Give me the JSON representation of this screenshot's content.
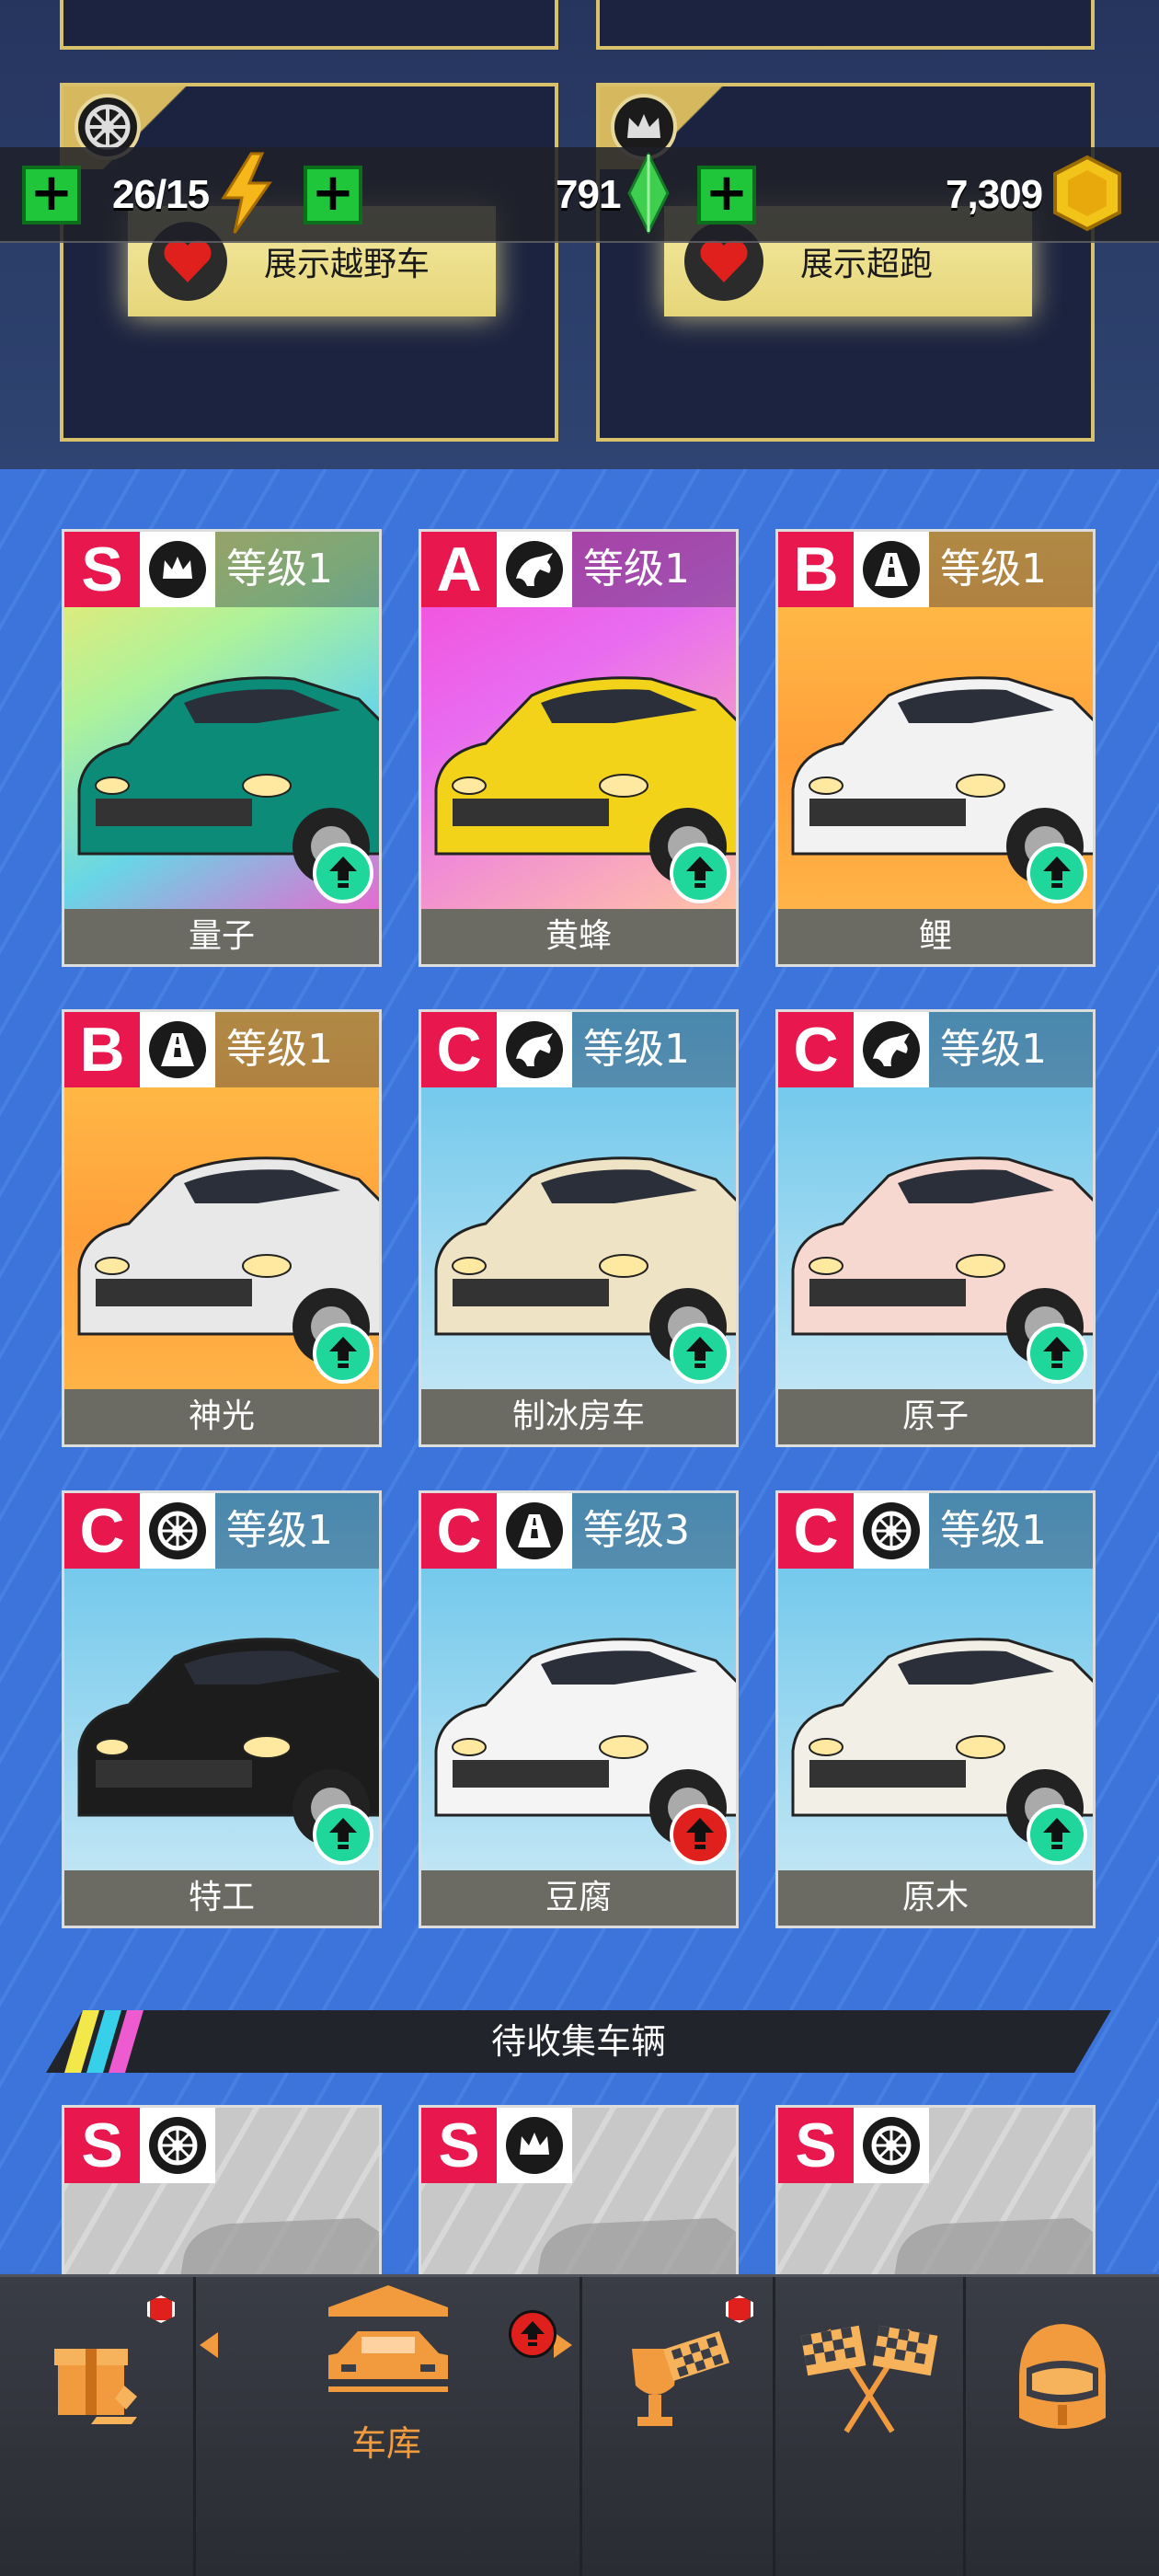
{
  "showcase": [
    {
      "label": "展示越野车",
      "icon": "wheel-icon"
    },
    {
      "label": "展示超跑",
      "icon": "crown-icon"
    }
  ],
  "currency": {
    "energy": "26/15",
    "gems": "791",
    "coins": "7,309"
  },
  "cars": [
    {
      "rank": "S",
      "level": "等级1",
      "name": "量子",
      "brand": "crown-icon",
      "art": "linear-gradient(150deg,#f9e76b 0%,#aef29a 35%,#68d6e6 65%,#e56bd0 100%)",
      "body": "#0c8c78",
      "upgrade": "green"
    },
    {
      "rank": "A",
      "level": "等级1",
      "name": "黄蜂",
      "brand": "horse-icon",
      "art": "linear-gradient(150deg,#f64bd6 0%,#e86cf0 40%,#ffc3a6 100%)",
      "body": "#f2d31a",
      "upgrade": "green"
    },
    {
      "rank": "B",
      "level": "等级1",
      "name": "鲤",
      "brand": "road-icon",
      "art": "linear-gradient(180deg,#ffc44a 0%,#ff9f3a 60%,#ffb347 100%)",
      "body": "#f2f2f2",
      "upgrade": "green"
    },
    {
      "rank": "B",
      "level": "等级1",
      "name": "神光",
      "brand": "road-icon",
      "art": "linear-gradient(180deg,#ffc44a 0%,#ff9f3a 60%,#ffb347 100%)",
      "body": "#e8e8e8",
      "upgrade": "green"
    },
    {
      "rank": "C",
      "level": "等级1",
      "name": "制冰房车",
      "brand": "horse-icon",
      "art": "linear-gradient(180deg,#62c2ea 0%,#bfe5f4 100%)",
      "body": "#efe3c6",
      "upgrade": "green"
    },
    {
      "rank": "C",
      "level": "等级1",
      "name": "原子",
      "brand": "horse-icon",
      "art": "linear-gradient(180deg,#62c2ea 0%,#bfe5f4 100%)",
      "body": "#f7d8d0",
      "upgrade": "green"
    },
    {
      "rank": "C",
      "level": "等级1",
      "name": "特工",
      "brand": "wheel-icon",
      "art": "linear-gradient(180deg,#62c2ea 0%,#bfe5f4 100%)",
      "body": "#1c1c1c",
      "upgrade": "green"
    },
    {
      "rank": "C",
      "level": "等级3",
      "name": "豆腐",
      "brand": "road-icon",
      "art": "linear-gradient(180deg,#62c2ea 0%,#bfe5f4 100%)",
      "body": "#f4f4f4",
      "upgrade": "red"
    },
    {
      "rank": "C",
      "level": "等级1",
      "name": "原木",
      "brand": "wheel-icon",
      "art": "linear-gradient(180deg,#62c2ea 0%,#bfe5f4 100%)",
      "body": "#f2efe6",
      "upgrade": "green"
    }
  ],
  "pending": {
    "title": "待收集车辆",
    "cards": [
      {
        "rank": "S",
        "brand": "wheel-icon"
      },
      {
        "rank": "S",
        "brand": "crown-icon"
      },
      {
        "rank": "S",
        "brand": "wheel-icon"
      }
    ]
  },
  "nav": {
    "garage_label": "车库",
    "items": [
      "shop-icon",
      "garage-icon",
      "trophy-icon",
      "race-flags-icon",
      "helmet-icon"
    ]
  },
  "colors": {
    "rank_red": "#e8174d",
    "upgrade_green": "#1fd79b",
    "upgrade_red": "#e0201c",
    "accent_orange": "#f19a3e",
    "gold_border": "#d9c06a"
  }
}
